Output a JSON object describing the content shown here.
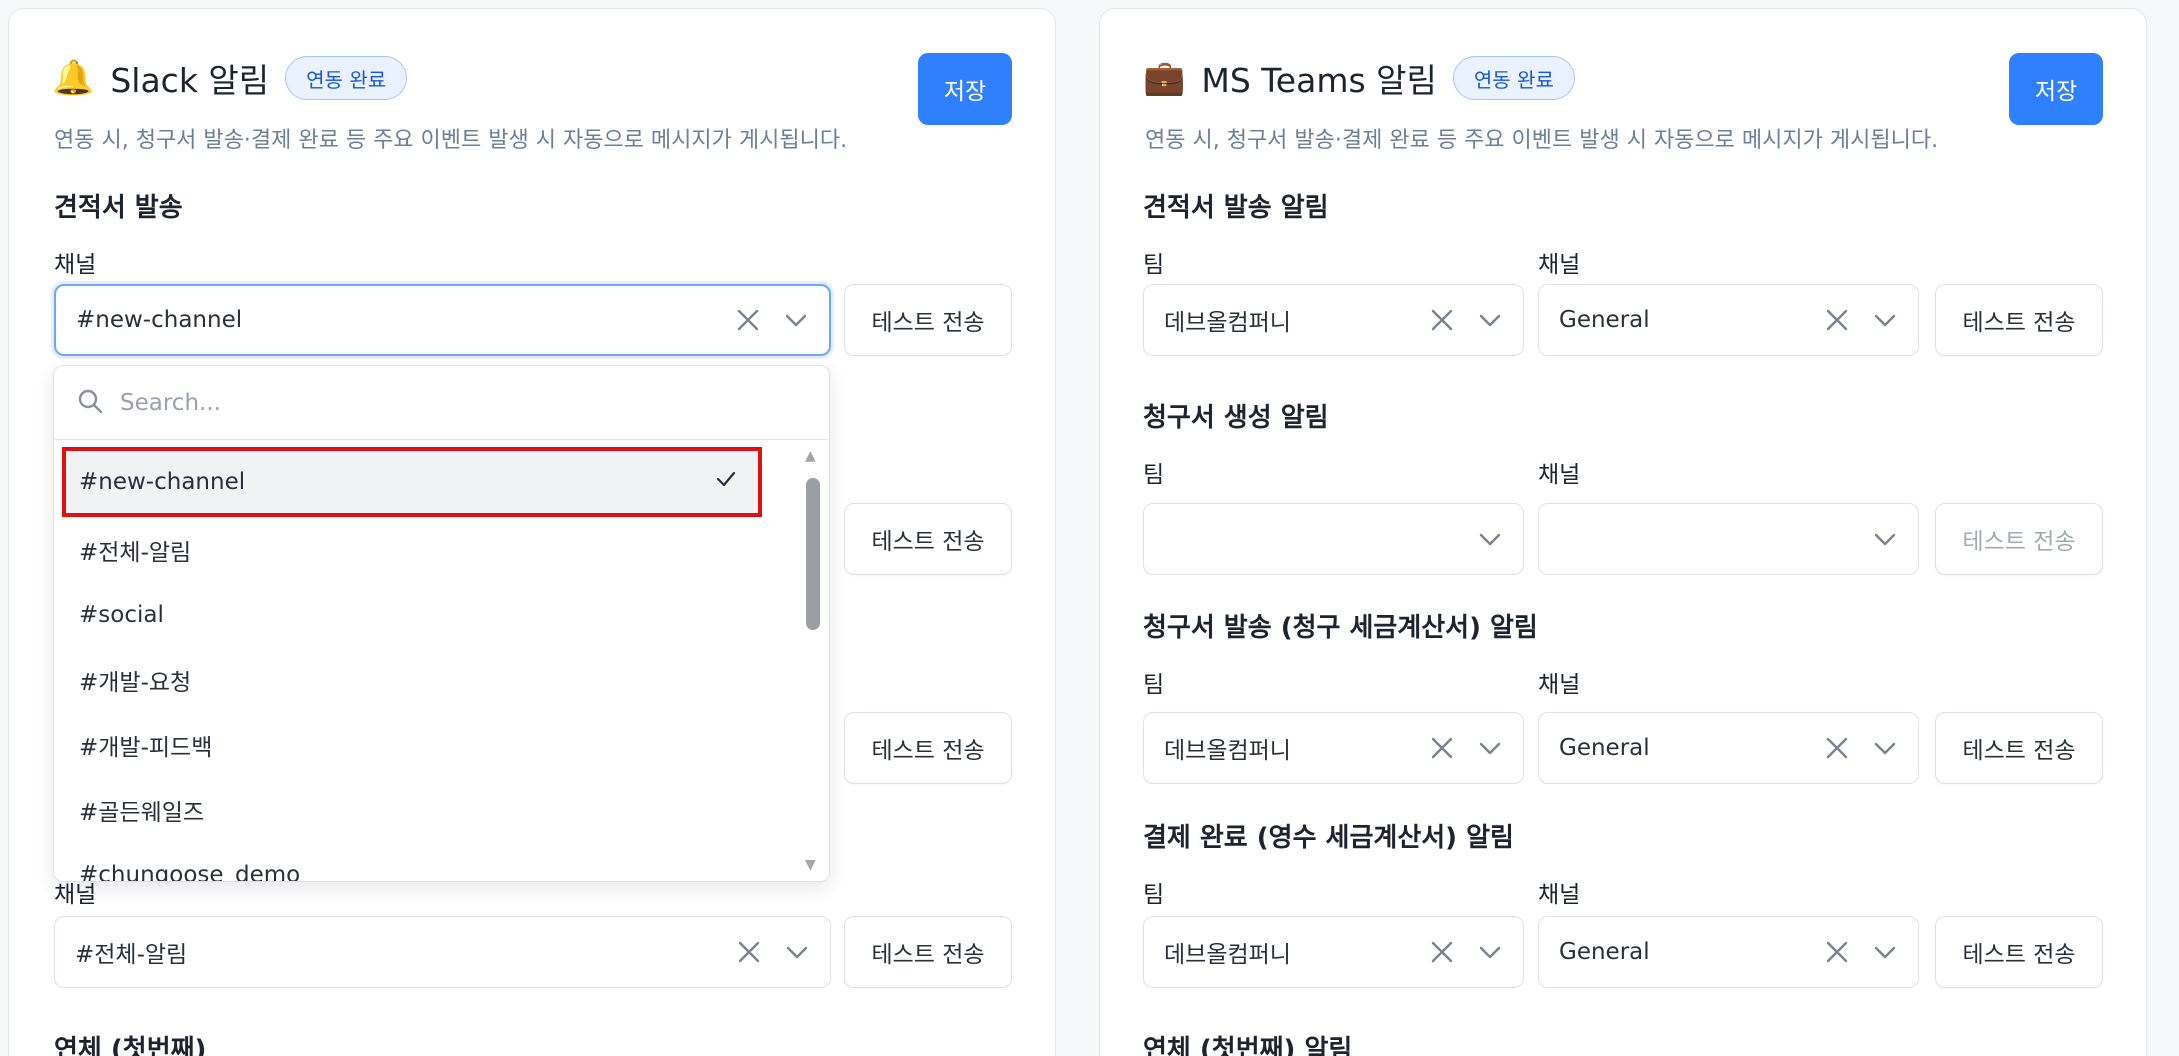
{
  "common": {
    "description": "연동 시, 청구서 발송·결제 완료 등 주요 이벤트 발생 시 자동으로 메시지가 게시됩니다.",
    "save_label": "저장",
    "badge_label": "연동 완료",
    "test_label": "테스트 전송",
    "label_team": "팀",
    "label_channel": "채널"
  },
  "slack": {
    "icon": "bell-icon",
    "title": "Slack 알림",
    "section1_title": "견적서 발송",
    "section1_channel": "#new-channel",
    "partial_label": "채널",
    "section4_channel": "#전체-알림",
    "section5_title": "연체 (첫번째)",
    "dropdown": {
      "search_placeholder": "Search...",
      "options": [
        "#new-channel",
        "#전체-알림",
        "#social",
        "#개발-요청",
        "#개발-피드백",
        "#골든웨일즈",
        "#chungoose_demo"
      ],
      "selected_index": 0
    }
  },
  "teams": {
    "icon": "briefcase-icon",
    "title": "MS Teams 알림",
    "sections": [
      {
        "title": "견적서 발송 알림",
        "team": "데브올컴퍼니",
        "channel": "General"
      },
      {
        "title": "청구서 생성 알림",
        "team": "",
        "channel": ""
      },
      {
        "title": "청구서 발송 (청구 세금계산서) 알림",
        "team": "데브올컴퍼니",
        "channel": "General"
      },
      {
        "title": "결제 완료 (영수 세금계산서) 알림",
        "team": "데브올컴퍼니",
        "channel": "General"
      }
    ],
    "section5_title": "연체 (첫번째) 알림"
  },
  "colors": {
    "primary": "#2f80ff",
    "badge_bg": "#eaf2ff",
    "badge_text": "#1a56db",
    "highlight_outline": "#e01010"
  }
}
